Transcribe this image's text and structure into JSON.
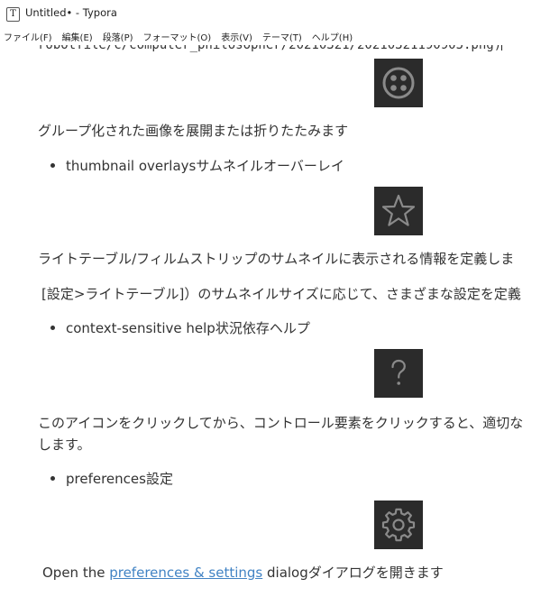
{
  "window": {
    "title": "Untitled• - Typora",
    "app_icon_letter": "T"
  },
  "menu": [
    {
      "label": "ファイル(F)"
    },
    {
      "label": "編集(E)"
    },
    {
      "label": "段落(P)"
    },
    {
      "label": "フォーマット(O)"
    },
    {
      "label": "表示(V)"
    },
    {
      "label": "テーマ(T)"
    },
    {
      "label": "ヘルプ(H)"
    }
  ],
  "content": {
    "code_line": "robotfile/c/computer_philosopher/20210321/20210321190905.png)",
    "blocks": [
      {
        "type": "icon",
        "icon": "group-expand-icon"
      },
      {
        "type": "paragraph",
        "text": "グループ化された画像を展開または折りたたみます"
      },
      {
        "type": "bullet",
        "text": "thumbnail overlaysサムネイルオーバーレイ"
      },
      {
        "type": "icon",
        "icon": "star-icon"
      },
      {
        "type": "paragraph",
        "text": "ライトテーブル/フィルムストリップのサムネイルに表示される情報を定義しま"
      },
      {
        "type": "paragraph",
        "text": "[設定>ライトテーブル]）のサムネイルサイズに応じて、さまざまな設定を定義"
      },
      {
        "type": "bullet",
        "text": "context-sensitive help状況依存ヘルプ"
      },
      {
        "type": "icon",
        "icon": "question-icon"
      },
      {
        "type": "paragraph",
        "text": "このアイコンをクリックしてから、コントロール要素をクリックすると、適切な"
      },
      {
        "type": "paragraph",
        "text": "します。"
      },
      {
        "type": "bullet",
        "text": "preferences設定"
      },
      {
        "type": "icon",
        "icon": "gear-icon"
      }
    ],
    "last_paragraph": {
      "before": "Open the ",
      "link": "preferences & settings",
      "after": " dialogダイアログを開きます"
    }
  },
  "colors": {
    "icon_bg": "#2b2b2b",
    "icon_fg": "#8a8a8a",
    "link": "#4183c4",
    "text": "#333333"
  }
}
